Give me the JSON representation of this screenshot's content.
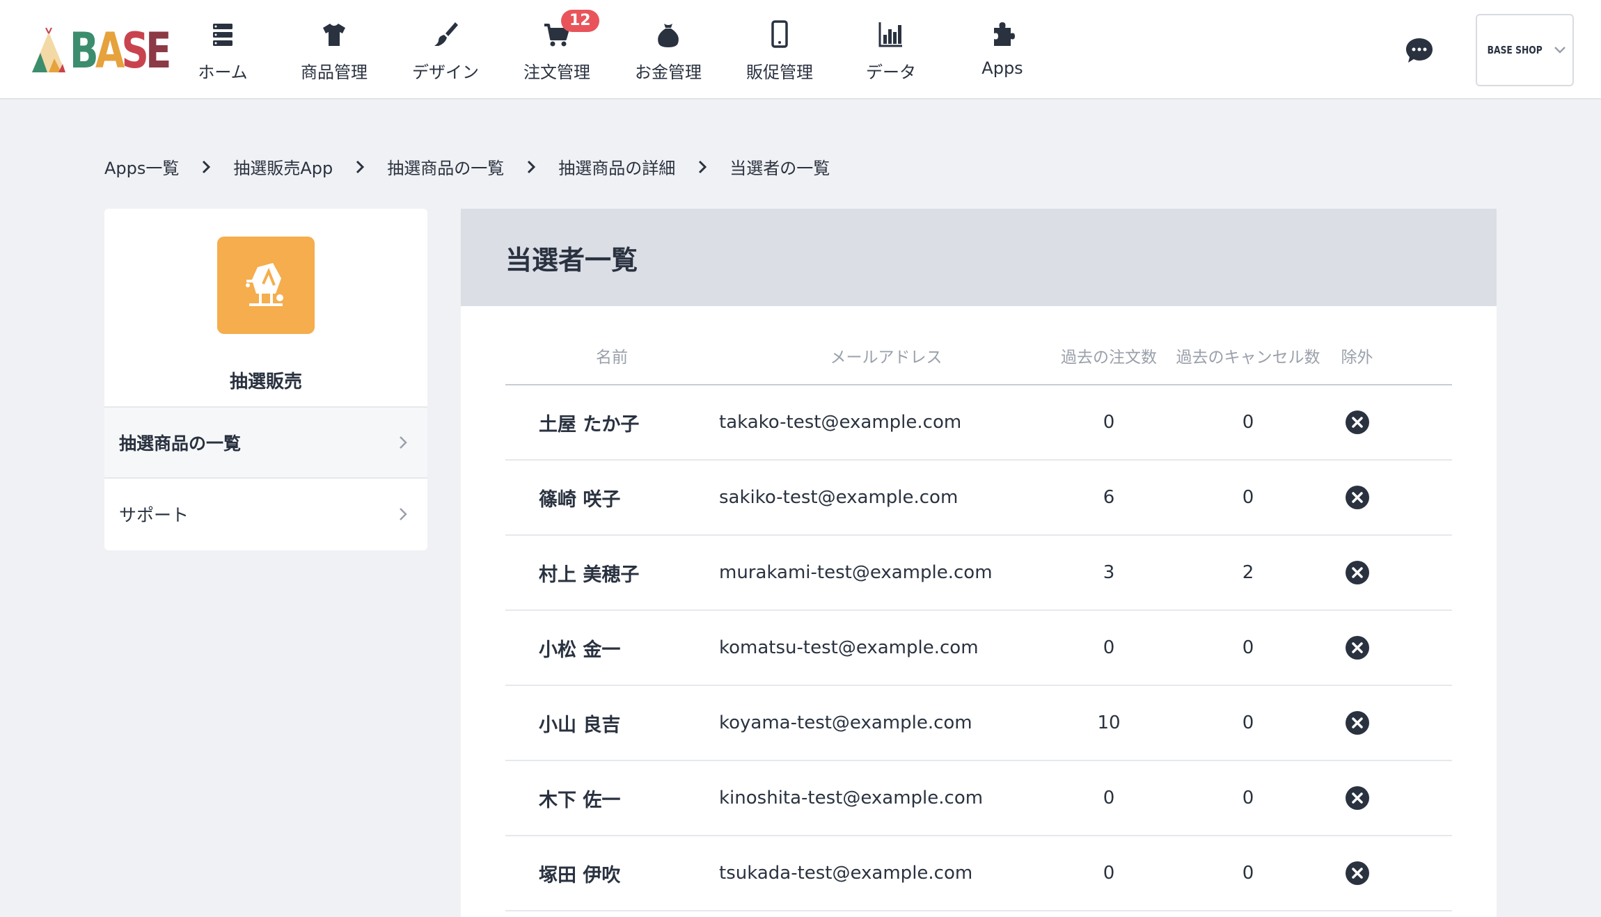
{
  "header": {
    "nav": [
      {
        "label": "ホーム",
        "icon": "home-icon"
      },
      {
        "label": "商品管理",
        "icon": "tshirt-icon"
      },
      {
        "label": "デザイン",
        "icon": "brush-icon"
      },
      {
        "label": "注文管理",
        "icon": "cart-icon",
        "badge": "12"
      },
      {
        "label": "お金管理",
        "icon": "money-bag-icon"
      },
      {
        "label": "販促管理",
        "icon": "smartphone-icon"
      },
      {
        "label": "データ",
        "icon": "bar-chart-icon"
      },
      {
        "label": "Apps",
        "icon": "puzzle-icon"
      }
    ],
    "shop_label": "BASE SHOP"
  },
  "breadcrumb": {
    "items": [
      "Apps一覧",
      "抽選販売App",
      "抽選商品の一覧",
      "抽選商品の詳細"
    ],
    "current": "当選者の一覧"
  },
  "sidebar": {
    "app_name": "抽選販売",
    "items": [
      {
        "label": "抽選商品の一覧",
        "active": true
      },
      {
        "label": "サポート",
        "active": false
      }
    ]
  },
  "main": {
    "title": "当選者一覧",
    "columns": {
      "name": "名前",
      "email": "メールアドレス",
      "orders": "過去の注文数",
      "cancels": "過去のキャンセル数",
      "exclude": "除外"
    },
    "rows": [
      {
        "name": "土屋 たか子",
        "email": "takako-test@example.com",
        "orders": "0",
        "cancels": "0"
      },
      {
        "name": "篠崎 咲子",
        "email": "sakiko-test@example.com",
        "orders": "6",
        "cancels": "0"
      },
      {
        "name": "村上 美穂子",
        "email": "murakami-test@example.com",
        "orders": "3",
        "cancels": "2"
      },
      {
        "name": "小松 金一",
        "email": "komatsu-test@example.com",
        "orders": "0",
        "cancels": "0"
      },
      {
        "name": "小山 良吉",
        "email": "koyama-test@example.com",
        "orders": "10",
        "cancels": "0"
      },
      {
        "name": "木下 佐一",
        "email": "kinoshita-test@example.com",
        "orders": "0",
        "cancels": "0"
      },
      {
        "name": "塚田 伊吹",
        "email": "tsukada-test@example.com",
        "orders": "0",
        "cancels": "0"
      }
    ]
  },
  "colors": {
    "accent": "#f5ad4d",
    "badge": "#e8545a",
    "text": "#2a3240",
    "background": "#f0f1f4"
  }
}
